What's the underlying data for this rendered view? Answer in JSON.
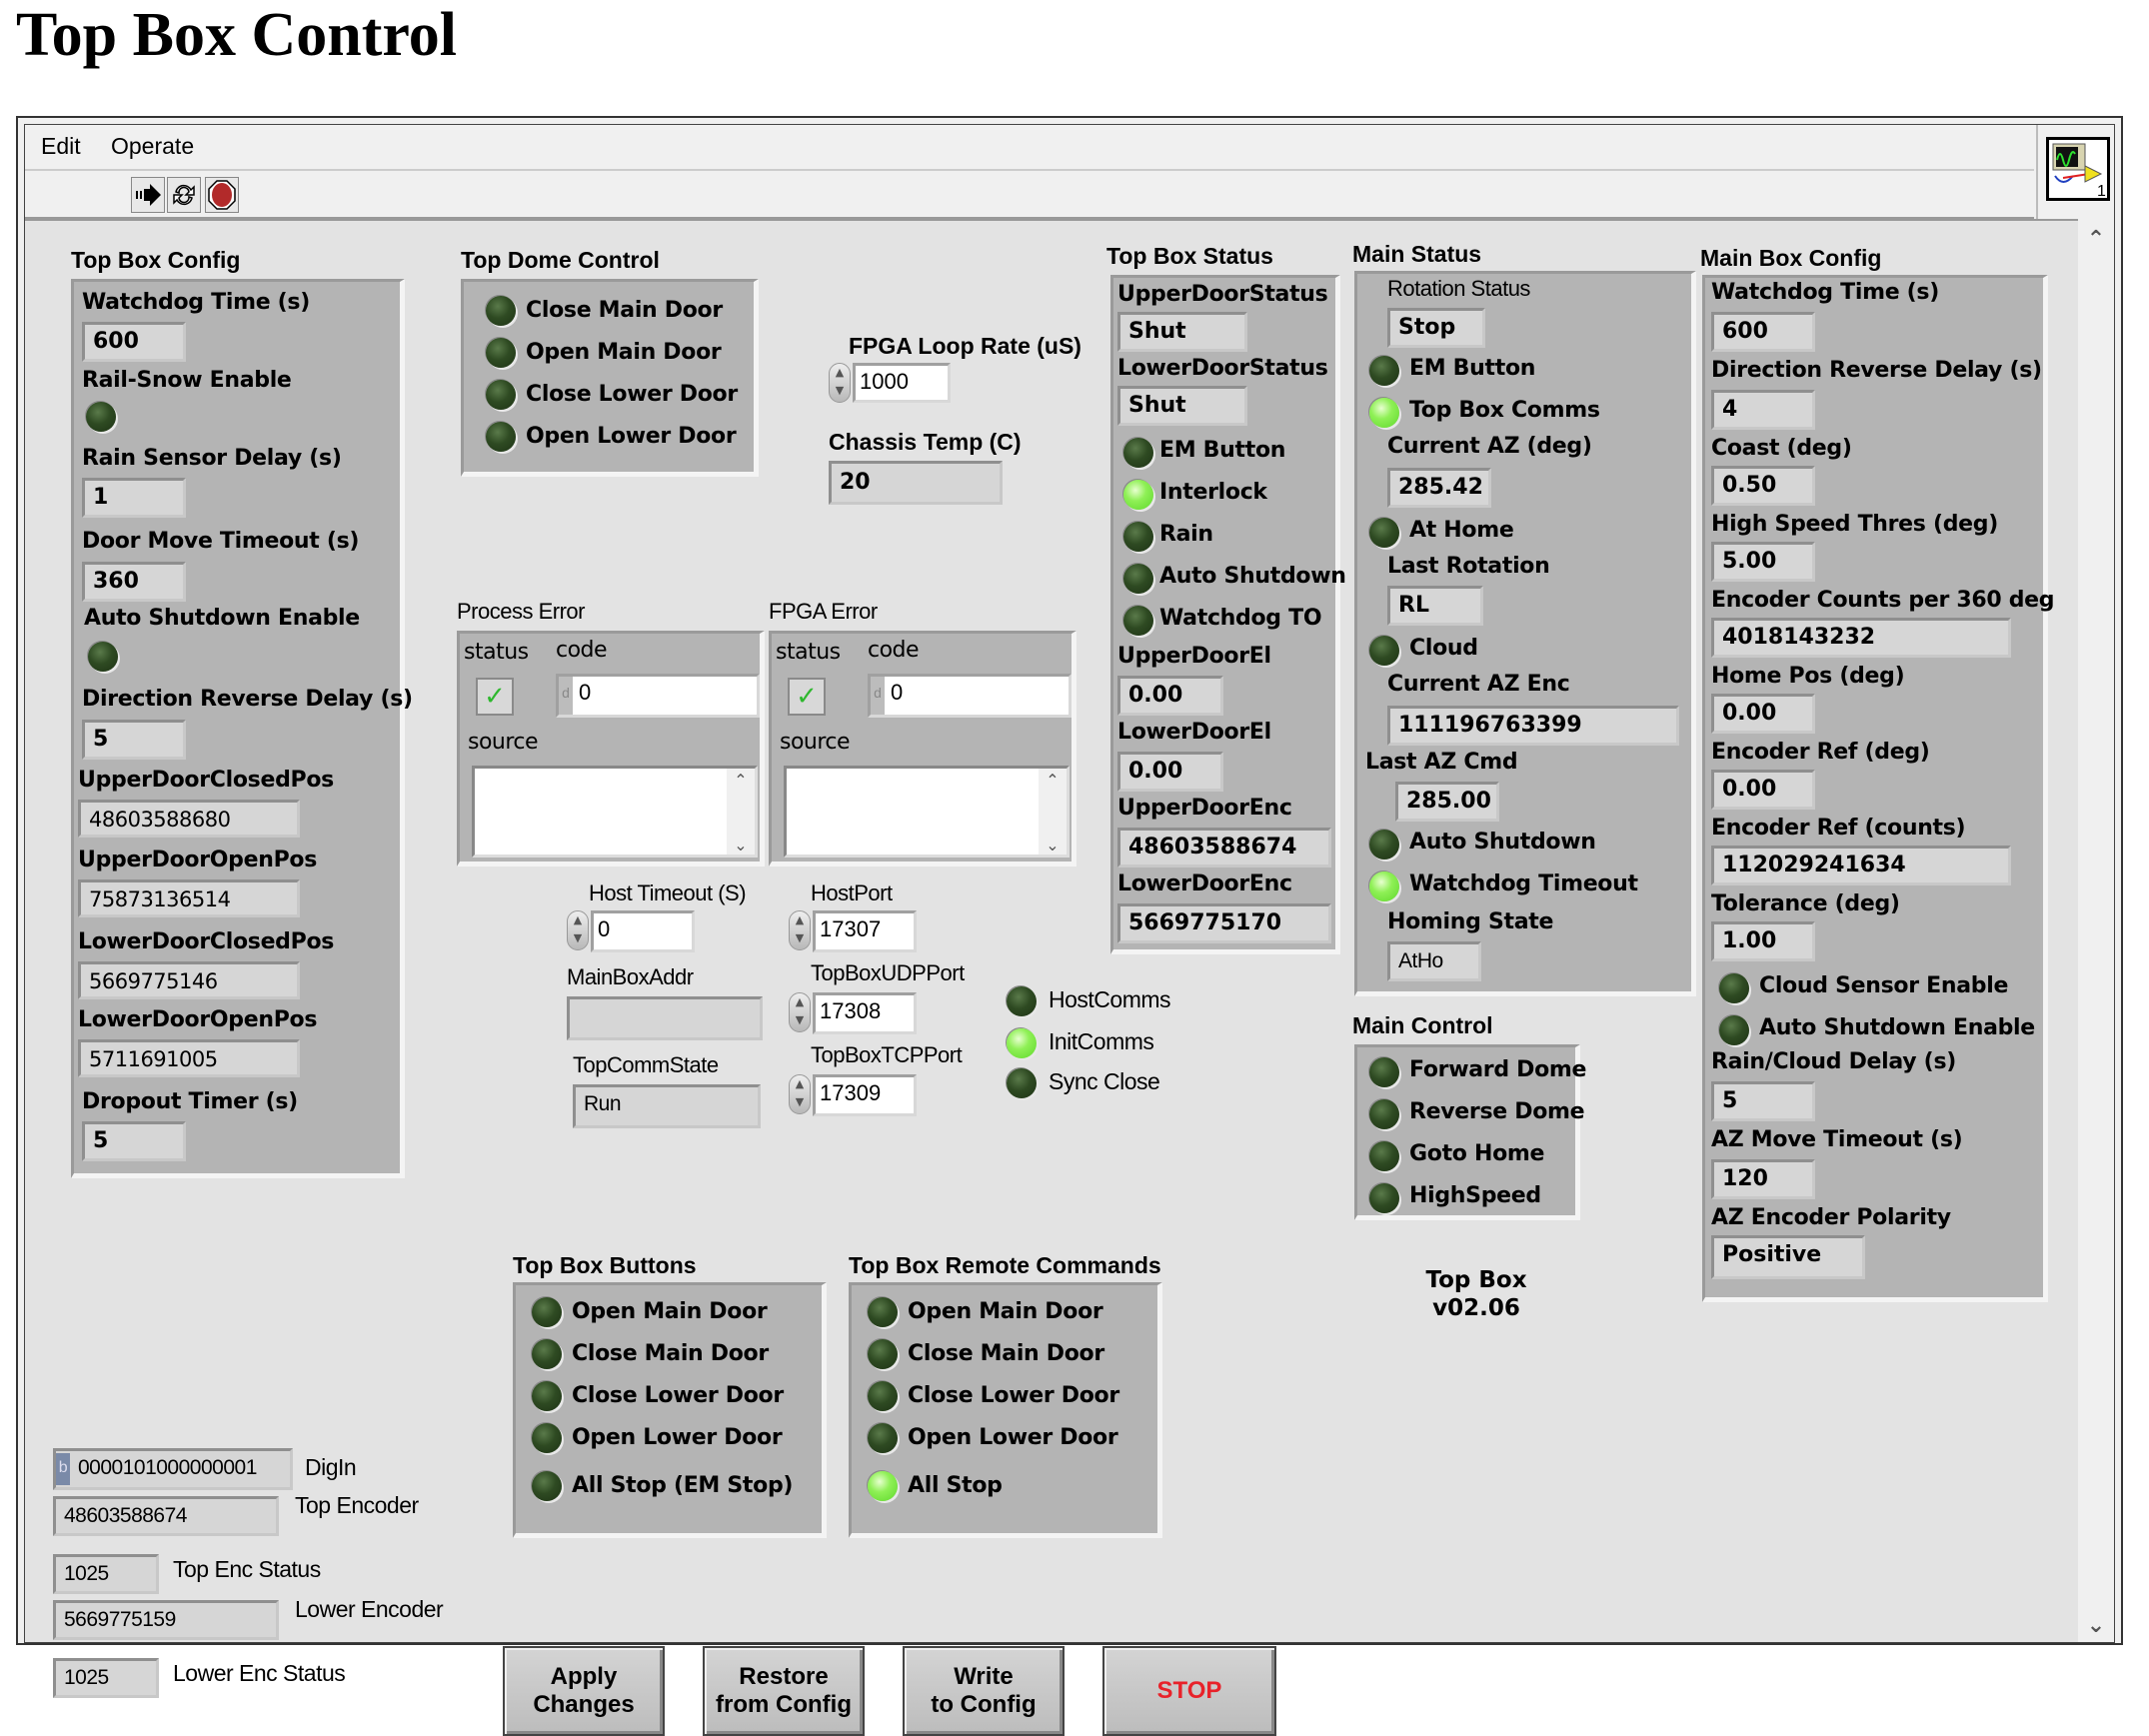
{
  "page_title": "Top Box Control",
  "menu": {
    "edit": "Edit",
    "operate": "Operate"
  },
  "toolbar": {
    "run": "run-continuously",
    "run_continuous": "run-continuous",
    "abort": "abort"
  },
  "vi_icon": {
    "number": "1"
  },
  "top_box_config": {
    "title": "Top Box Config",
    "watchdog_label": "Watchdog Time (s)",
    "watchdog_value": "600",
    "rail_snow_label": "Rail-Snow Enable",
    "rail_snow_on": false,
    "rain_delay_label": "Rain Sensor Delay (s)",
    "rain_delay_value": "1",
    "door_timeout_label": "Door Move Timeout (s)",
    "door_timeout_value": "360",
    "auto_shutdown_label": "Auto Shutdown Enable",
    "auto_shutdown_on": false,
    "dir_rev_label": "Direction Reverse Delay (s)",
    "dir_rev_value": "5",
    "upper_closed_label": "UpperDoorClosedPos",
    "upper_closed_value": "48603588680",
    "upper_open_label": "UpperDoorOpenPos",
    "upper_open_value": "75873136514",
    "lower_closed_label": "LowerDoorClosedPos",
    "lower_closed_value": "5669775146",
    "lower_open_label": "LowerDoorOpenPos",
    "lower_open_value": "5711691005",
    "dropout_label": "Dropout Timer (s)",
    "dropout_value": "5"
  },
  "top_dome_control": {
    "title": "Top Dome Control",
    "items": [
      {
        "label": "Close Main Door",
        "on": false
      },
      {
        "label": "Open Main Door",
        "on": false
      },
      {
        "label": "Close Lower Door",
        "on": false
      },
      {
        "label": "Open Lower Door",
        "on": false
      }
    ]
  },
  "fpga": {
    "loop_rate_label": "FPGA Loop Rate (uS)",
    "loop_rate_value": "1000",
    "chassis_temp_label": "Chassis Temp (C)",
    "chassis_temp_value": "20"
  },
  "process_error": {
    "title": "Process Error",
    "status_label": "status",
    "code_label": "code",
    "code_value": "0",
    "source_label": "source",
    "source_value": "",
    "status_ok": true
  },
  "fpga_error": {
    "title": "FPGA Error",
    "status_label": "status",
    "code_label": "code",
    "code_value": "0",
    "source_label": "source",
    "source_value": "",
    "status_ok": true
  },
  "comms": {
    "host_timeout_label": "Host Timeout (S)",
    "host_timeout_value": "0",
    "host_port_label": "HostPort",
    "host_port_value": "17307",
    "udp_port_label": "TopBoxUDPPort",
    "udp_port_value": "17308",
    "tcp_port_label": "TopBoxTCPPort",
    "tcp_port_value": "17309",
    "mainbox_addr_label": "MainBoxAddr",
    "mainbox_addr_value": "",
    "comm_state_label": "TopCommState",
    "comm_state_value": "Run",
    "leds": [
      {
        "label": "HostComms",
        "on": false
      },
      {
        "label": "InitComms",
        "on": true
      },
      {
        "label": "Sync Close",
        "on": false
      }
    ]
  },
  "top_box_status": {
    "title": "Top Box Status",
    "upper_status_label": "UpperDoorStatus",
    "upper_status_value": "Shut",
    "lower_status_label": "LowerDoorStatus",
    "lower_status_value": "Shut",
    "leds": [
      {
        "label": "EM Button",
        "on": false
      },
      {
        "label": "Interlock",
        "on": true
      },
      {
        "label": "Rain",
        "on": false
      },
      {
        "label": "Auto Shutdown",
        "on": false
      },
      {
        "label": "Watchdog TO",
        "on": false
      }
    ],
    "upper_el_label": "UpperDoorEl",
    "upper_el_value": "0.00",
    "lower_el_label": "LowerDoorEl",
    "lower_el_value": "0.00",
    "upper_enc_label": "UpperDoorEnc",
    "upper_enc_value": "48603588674",
    "lower_enc_label": "LowerDoorEnc",
    "lower_enc_value": "5669775170"
  },
  "main_status": {
    "title": "Main Status",
    "rotation_label": "Rotation Status",
    "rotation_value": "Stop",
    "em_button_label": "EM Button",
    "em_button_on": false,
    "comms_label": "Top Box Comms",
    "comms_on": true,
    "current_az_label": "Current AZ (deg)",
    "current_az_value": "285.42",
    "at_home_label": "At Home",
    "at_home_on": false,
    "last_rotation_label": "Last Rotation",
    "last_rotation_value": "RL",
    "cloud_label": "Cloud",
    "cloud_on": false,
    "az_enc_label": "Current AZ Enc",
    "az_enc_value": "111196763399",
    "last_cmd_label": "Last AZ Cmd",
    "last_cmd_value": "285.00",
    "auto_shutdown_label": "Auto Shutdown",
    "auto_shutdown_on": false,
    "watchdog_label": "Watchdog Timeout",
    "watchdog_on": true,
    "homing_label": "Homing State",
    "homing_value": "AtHo"
  },
  "main_control": {
    "title": "Main Control",
    "items": [
      {
        "label": "Forward Dome",
        "on": false
      },
      {
        "label": "Reverse Dome",
        "on": false
      },
      {
        "label": "Goto Home",
        "on": false
      },
      {
        "label": "HighSpeed",
        "on": false
      }
    ]
  },
  "version": {
    "line1": "Top Box",
    "line2": "v02.06"
  },
  "main_box_config": {
    "title": "Main Box Config",
    "watchdog_label": "Watchdog Time (s)",
    "watchdog_value": "600",
    "dir_rev_label": "Direction Reverse Delay (s)",
    "dir_rev_value": "4",
    "coast_label": "Coast (deg)",
    "coast_value": "0.50",
    "hs_thres_label": "High Speed Thres (deg)",
    "hs_thres_value": "5.00",
    "enc_counts_label": "Encoder Counts per 360 deg",
    "enc_counts_value": "4018143232",
    "home_pos_label": "Home Pos (deg)",
    "home_pos_value": "0.00",
    "enc_ref_deg_label": "Encoder Ref (deg)",
    "enc_ref_deg_value": "0.00",
    "enc_ref_counts_label": "Encoder Ref (counts)",
    "enc_ref_counts_value": "112029241634",
    "tolerance_label": "Tolerance (deg)",
    "tolerance_value": "1.00",
    "cloud_enable_label": "Cloud Sensor Enable",
    "cloud_enable_on": false,
    "auto_shutdown_label": "Auto Shutdown Enable",
    "auto_shutdown_on": false,
    "rain_cloud_label": "Rain/Cloud Delay (s)",
    "rain_cloud_value": "5",
    "az_timeout_label": "AZ Move Timeout (s)",
    "az_timeout_value": "120",
    "polarity_label": "AZ Encoder Polarity",
    "polarity_value": "Positive"
  },
  "top_box_buttons": {
    "title": "Top Box Buttons",
    "items": [
      {
        "label": "Open Main Door",
        "on": false
      },
      {
        "label": "Close Main Door",
        "on": false
      },
      {
        "label": "Close Lower Door",
        "on": false
      },
      {
        "label": "Open Lower Door",
        "on": false
      },
      {
        "label": "All Stop (EM Stop)",
        "on": false
      }
    ]
  },
  "top_box_remote": {
    "title": "Top Box Remote Commands",
    "items": [
      {
        "label": "Open Main Door",
        "on": false
      },
      {
        "label": "Close Main Door",
        "on": false
      },
      {
        "label": "Close Lower Door",
        "on": false
      },
      {
        "label": "Open Lower Door",
        "on": false
      },
      {
        "label": "All Stop",
        "on": true
      }
    ]
  },
  "io": {
    "digin_prefix": "b",
    "digin_value": "0000101000000001",
    "digin_label": "DigIn",
    "top_enc_value": "48603588674",
    "top_enc_label": "Top Encoder",
    "top_enc_status_value": "1025",
    "top_enc_status_label": "Top Enc Status",
    "lower_enc_value": "5669775159",
    "lower_enc_label": "Lower Encoder",
    "lower_enc_status_value": "1025",
    "lower_enc_status_label": "Lower Enc Status"
  },
  "buttons": {
    "apply": "Apply\nChanges",
    "restore": "Restore\nfrom Config",
    "write": "Write\nto Config",
    "stop": "STOP"
  },
  "colors": {
    "led_on": "#6fe23a",
    "led_off": "#2e4a22",
    "stop_text": "#e8222a",
    "cluster_bg": "#b4b4b4",
    "panel_bg": "#e3e3e3"
  }
}
